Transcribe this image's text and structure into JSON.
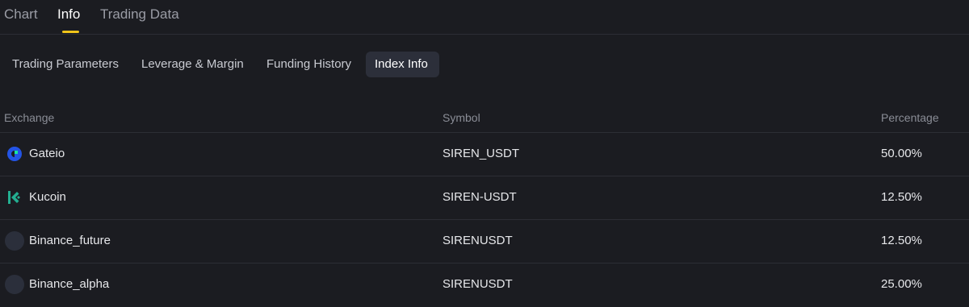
{
  "top_tabs": {
    "chart": "Chart",
    "info": "Info",
    "trading_data": "Trading Data"
  },
  "sub_tabs": {
    "trading_parameters": "Trading Parameters",
    "leverage_margin": "Leverage & Margin",
    "funding_history": "Funding History",
    "index_info": "Index Info"
  },
  "table": {
    "columns": [
      "Exchange",
      "Symbol",
      "Percentage"
    ],
    "rows": [
      {
        "exchange": "Gateio",
        "symbol": "SIREN_USDT",
        "percentage": "50.00%",
        "icon": "gateio-logo-icon"
      },
      {
        "exchange": "Kucoin",
        "symbol": "SIREN-USDT",
        "percentage": "12.50%",
        "icon": "kucoin-logo-icon"
      },
      {
        "exchange": "Binance_future",
        "symbol": "SIRENUSDT",
        "percentage": "12.50%",
        "icon": "placeholder-logo-icon"
      },
      {
        "exchange": "Binance_alpha",
        "symbol": "SIRENUSDT",
        "percentage": "25.00%",
        "icon": "placeholder-logo-icon"
      }
    ]
  },
  "colors": {
    "background": "#1b1c21",
    "accent_underline": "#f0c419",
    "active_subtab_bg": "#2c2f3a",
    "gateio_blue": "#2354e6",
    "gateio_green": "#17e6a1",
    "kucoin_green": "#23af91"
  }
}
